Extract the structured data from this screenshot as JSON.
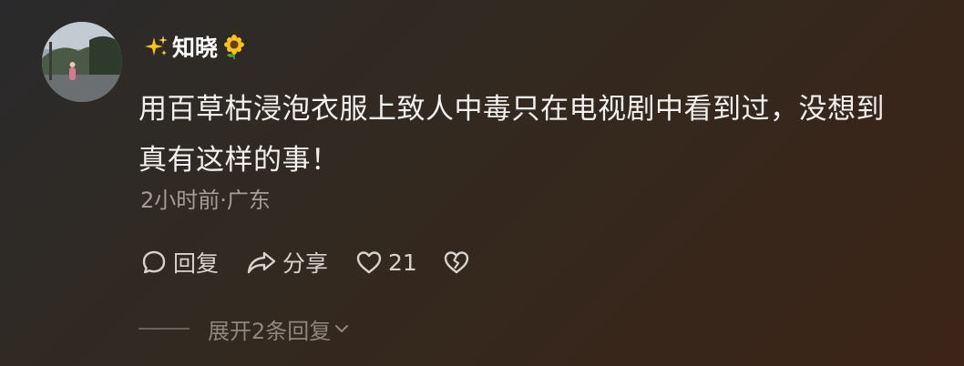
{
  "comment": {
    "username": "知晓",
    "username_prefix_icon": "sparkles-icon",
    "username_suffix_icon": "sunflower-icon",
    "text_line1": "用百草枯浸泡衣服上致人中毒只在电视剧中看到过，没想到",
    "text_line2": "真有这样的事！",
    "meta": "2小时前·广东",
    "actions": {
      "reply_label": "回复",
      "share_label": "分享",
      "like_count": "21"
    },
    "expand_label": "展开2条回复"
  }
}
